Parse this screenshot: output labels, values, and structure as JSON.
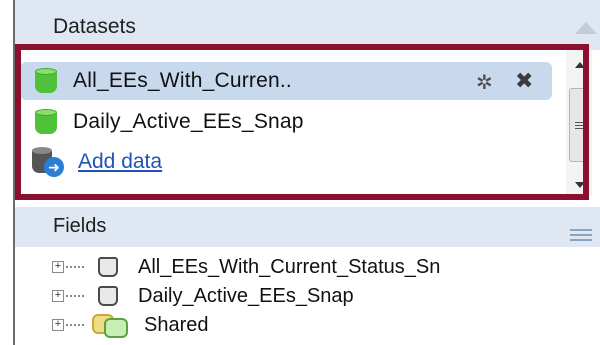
{
  "datasets_panel": {
    "title": "Datasets",
    "items": [
      {
        "label": "All_EEs_With_Curren..",
        "icon": "green-cylinder-icon",
        "selected": true
      },
      {
        "label": "Daily_Active_EEs_Snap",
        "icon": "green-cylinder-icon",
        "selected": false
      }
    ],
    "add_data_label": "Add data",
    "highlight_color": "#8b1030"
  },
  "fields_panel": {
    "title": "Fields",
    "items": [
      {
        "label": "All_EEs_With_Current_Status_Sn",
        "icon": "table-icon"
      },
      {
        "label": "Daily_Active_EEs_Snap",
        "icon": "table-icon"
      },
      {
        "label": "Shared",
        "icon": "shared-icon"
      }
    ]
  }
}
